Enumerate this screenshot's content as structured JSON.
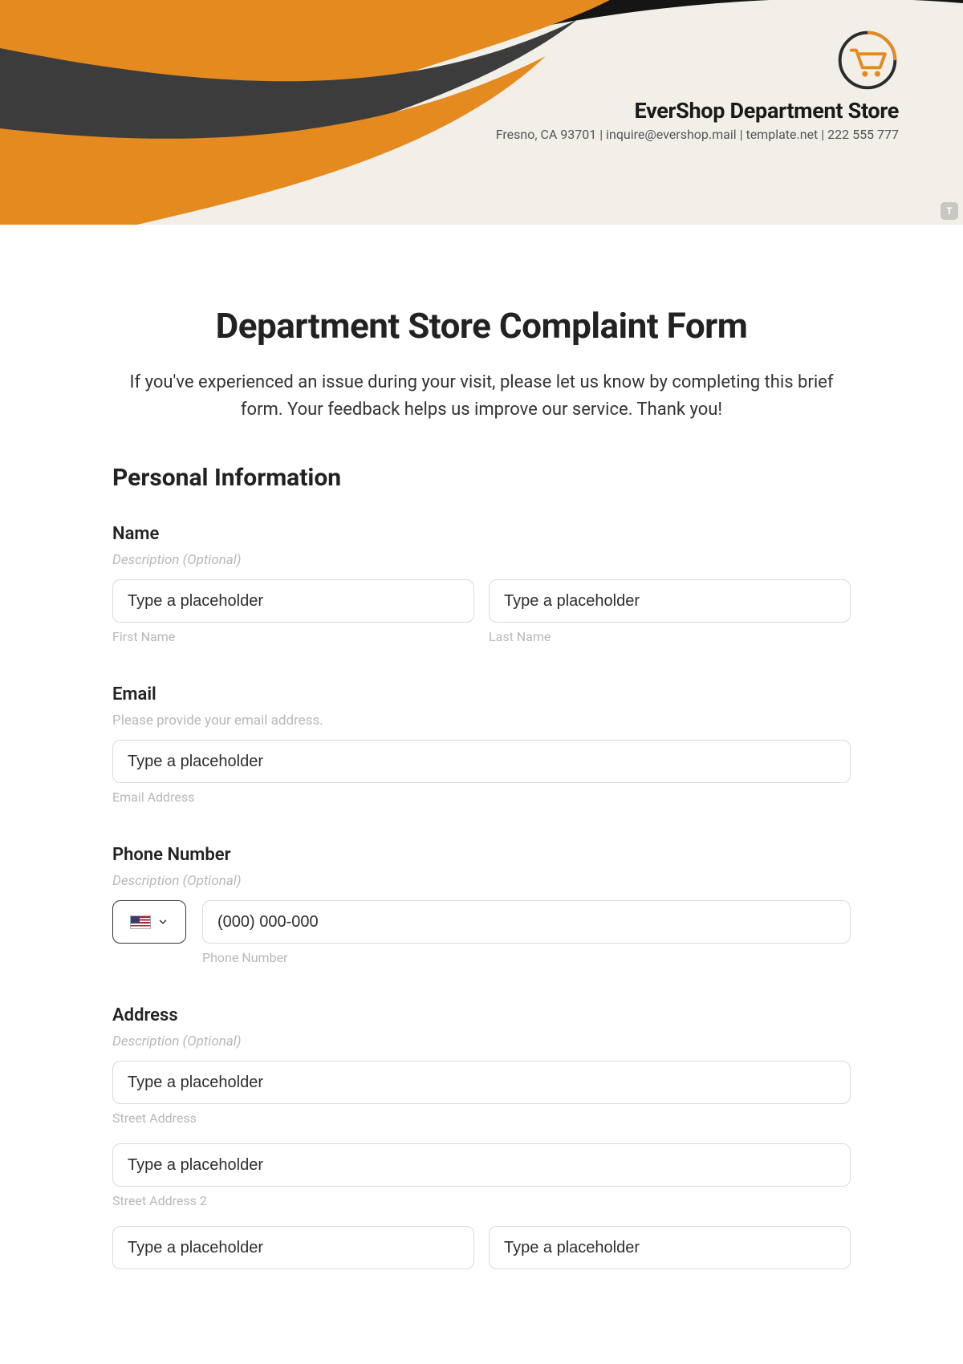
{
  "brand": {
    "name": "EverShop Department Store",
    "address_line": "Fresno, CA 93701 | inquire@evershop.mail | template.net | 222 555 777"
  },
  "form": {
    "title": "Department Store Complaint Form",
    "intro": "If you've experienced an issue during your visit, please let us know by completing this brief form. Your feedback helps us improve our service. Thank you!",
    "sections": {
      "personal": "Personal Information"
    }
  },
  "fields": {
    "name": {
      "label": "Name",
      "desc": "Description (Optional)",
      "first_ph": "Type a placeholder",
      "last_ph": "Type a placeholder",
      "first_sub": "First Name",
      "last_sub": "Last Name"
    },
    "email": {
      "label": "Email",
      "desc": "Please provide your email address.",
      "ph": "Type a placeholder",
      "sub": "Email Address"
    },
    "phone": {
      "label": "Phone Number",
      "desc": "Description (Optional)",
      "ph": "(000) 000-000",
      "sub": "Phone Number"
    },
    "address": {
      "label": "Address",
      "desc": "Description (Optional)",
      "street_ph": "Type a placeholder",
      "street_sub": "Street Address",
      "street2_ph": "Type a placeholder",
      "street2_sub": "Street Address 2",
      "city_ph": "Type a placeholder",
      "state_ph": "Type a placeholder"
    }
  },
  "corner_badge": "T"
}
